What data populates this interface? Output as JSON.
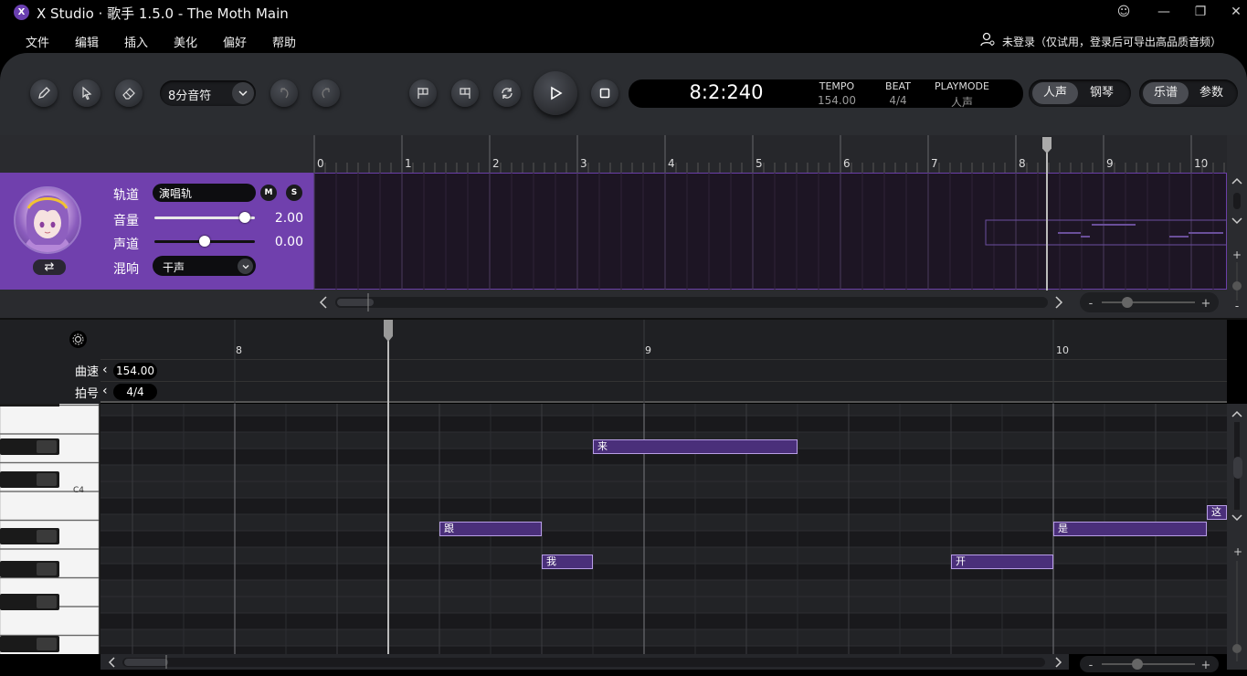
{
  "app": {
    "logo": "X",
    "title": "X Studio · 歌手 1.5.0 - The Moth Main"
  },
  "window_buttons": {
    "emoji": "☺",
    "minimize": "—",
    "restore": "❐",
    "close": "✕"
  },
  "menu": [
    "文件",
    "编辑",
    "插入",
    "美化",
    "偏好",
    "帮助"
  ],
  "login_text": "未登录（仅试用，登录后可导出高品质音频）",
  "toolbar": {
    "note_length": "8分音符",
    "time": "8:2:240",
    "tempo_label": "TEMPO",
    "tempo_value": "154.00",
    "beat_label": "BEAT",
    "beat_value": "4/4",
    "playmode_label": "PLAYMODE",
    "playmode_value": "人声",
    "mode_toggle": [
      "人声",
      "钢琴"
    ],
    "view_toggle": [
      "乐谱",
      "参数"
    ]
  },
  "overview_ruler": [
    "0",
    "1",
    "2",
    "3",
    "4",
    "5",
    "6",
    "7",
    "8",
    "9",
    "10"
  ],
  "track": {
    "track_label": "轨道",
    "track_name": "演唱轨",
    "mute": "M",
    "solo": "S",
    "volume_label": "音量",
    "volume_value": "2.00",
    "volume_level": 0.9,
    "pan_label": "声道",
    "pan_value": "0.00",
    "pan_level": 0.5,
    "reverb_label": "混响",
    "reverb_value": "干声",
    "swap": "⇄"
  },
  "piano_roll": {
    "bar_labels": [
      "8",
      "9",
      "10"
    ],
    "tempo_label": "曲速",
    "tempo_value": "154.00",
    "beat_label": "拍号",
    "beat_value": "4/4",
    "key_label": "C4",
    "notes": [
      {
        "lyric": "来"
      },
      {
        "lyric": "跟"
      },
      {
        "lyric": "我"
      },
      {
        "lyric": "开"
      },
      {
        "lyric": "是"
      },
      {
        "lyric": "这"
      }
    ]
  },
  "colors": {
    "accent_purple": "#7040ad",
    "note_fill": "#4a2f7a",
    "note_border": "#b89ee6"
  }
}
